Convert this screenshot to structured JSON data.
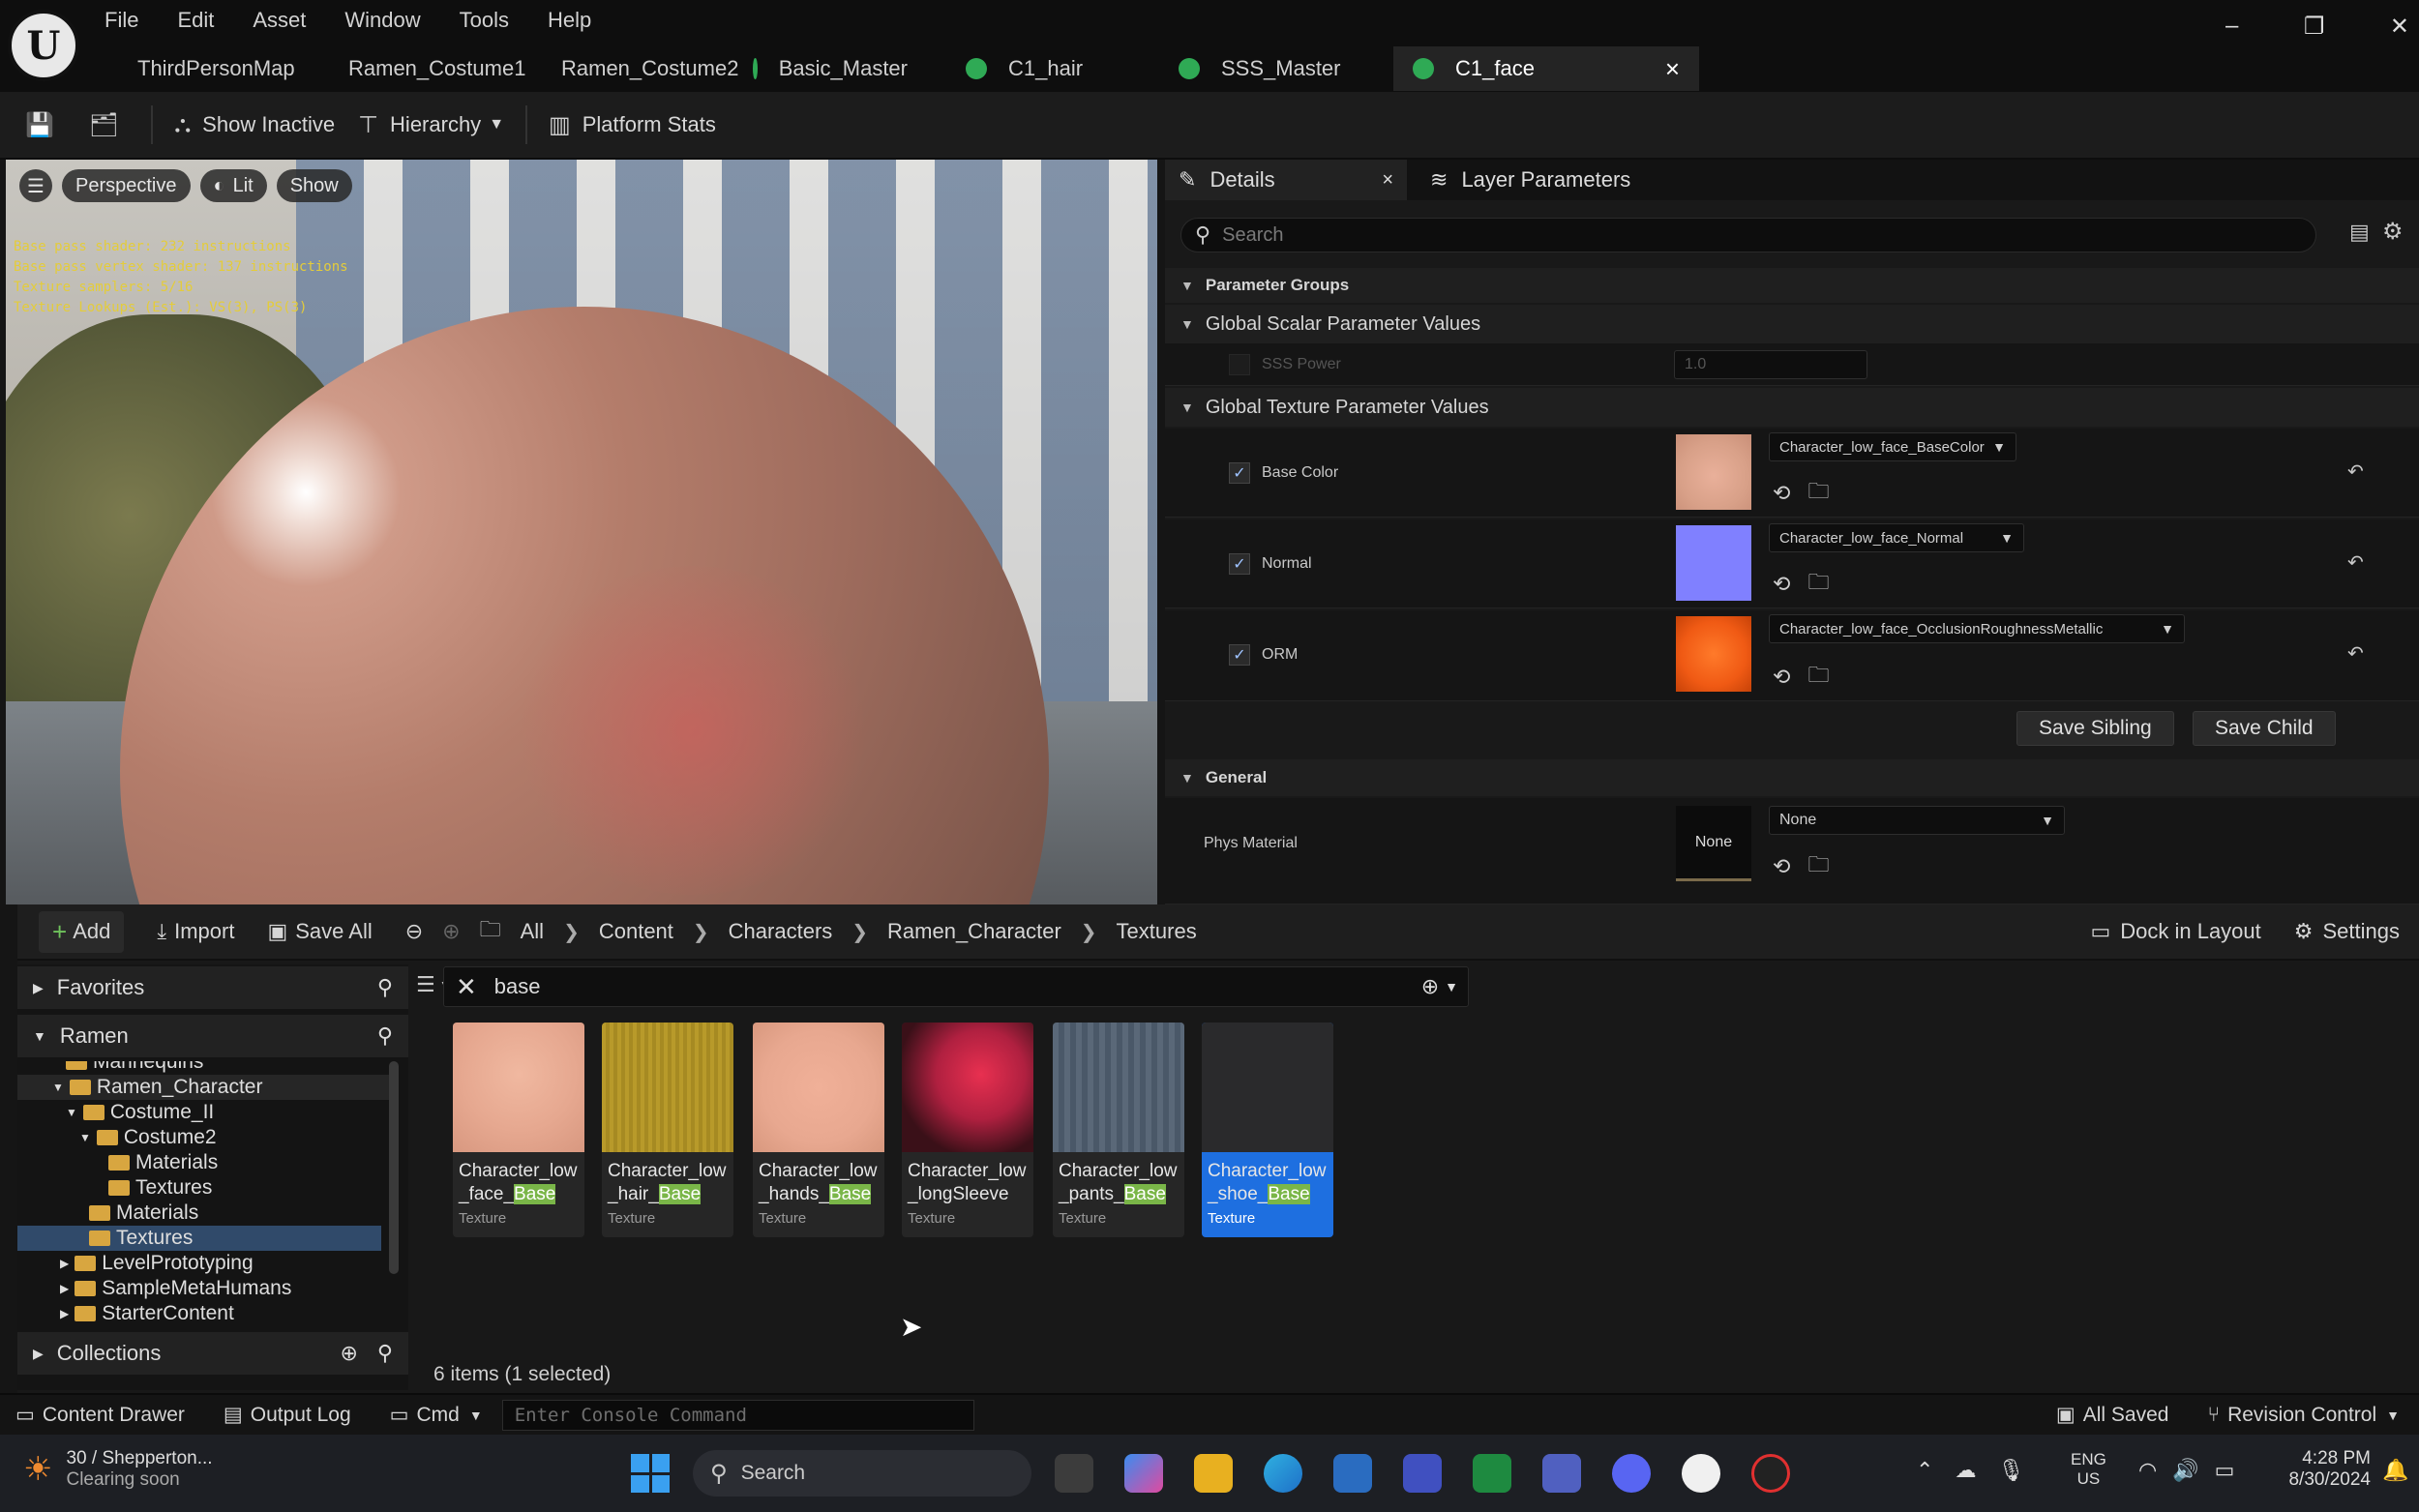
{
  "menu": [
    "File",
    "Edit",
    "Asset",
    "Window",
    "Tools",
    "Help"
  ],
  "tabs": [
    {
      "label": "ThirdPersonMap",
      "color": "#e0a020"
    },
    {
      "label": "Ramen_Costume1",
      "color": "#38a0a0"
    },
    {
      "label": "Ramen_Costume2",
      "color": "#38a0a0"
    },
    {
      "label": "Basic_Master",
      "color": "#2faa55"
    },
    {
      "label": "C1_hair",
      "color": "#2faa55"
    },
    {
      "label": "SSS_Master",
      "color": "#2faa55"
    },
    {
      "label": "C1_face",
      "color": "#2faa55",
      "active": true
    }
  ],
  "window": {
    "minimize": "–",
    "restore": "❐",
    "close": "✕",
    "tab_close": "×"
  },
  "toolbar": {
    "show_inactive": "Show Inactive",
    "hierarchy": "Hierarchy",
    "platform_stats": "Platform Stats"
  },
  "viewport": {
    "perspective": "Perspective",
    "lit": "Lit",
    "show": "Show",
    "stats": [
      "Base pass shader: 232 instructions",
      "Base pass vertex shader: 137 instructions",
      "Texture samplers: 5/16",
      "Texture Lookups (Est.): VS(3), PS(3)"
    ]
  },
  "details": {
    "tab_details": "Details",
    "tab_layer": "Layer Parameters",
    "search_placeholder": "Search",
    "parameter_groups": "Parameter Groups",
    "scalar_header": "Global Scalar Parameter Values",
    "sss_power_label": "SSS Power",
    "sss_power_value": "1.0",
    "texture_header": "Global Texture Parameter Values",
    "textures": [
      {
        "label": "Base Color",
        "asset": "Character_low_face_BaseColor",
        "checked": true,
        "swatch": "#d8a088"
      },
      {
        "label": "Normal",
        "asset": "Character_low_face_Normal",
        "checked": true,
        "swatch": "#8080ff"
      },
      {
        "label": "ORM",
        "asset": "Character_low_face_OcclusionRoughnessMetallic",
        "checked": true,
        "swatch": "#f05a14"
      }
    ],
    "save_sibling": "Save Sibling",
    "save_child": "Save Child",
    "general_header": "General",
    "phys_material_label": "Phys Material",
    "phys_material_thumb": "None",
    "phys_material_value": "None"
  },
  "drawer": {
    "add": "Add",
    "import": "Import",
    "save_all": "Save All",
    "breadcrumbs": [
      "All",
      "Content",
      "Characters",
      "Ramen_Character",
      "Textures"
    ],
    "dock": "Dock in Layout",
    "settings": "Settings",
    "favorites": "Favorites",
    "ramen": "Ramen",
    "collections": "Collections",
    "tree": [
      {
        "label": "Mannequins",
        "indent": 50
      },
      {
        "label": "Ramen_Character",
        "indent": 36
      },
      {
        "label": "Costume_II",
        "indent": 50
      },
      {
        "label": "Costume2",
        "indent": 64
      },
      {
        "label": "Materials",
        "indent": 80
      },
      {
        "label": "Textures",
        "indent": 80
      },
      {
        "label": "Materials",
        "indent": 60
      },
      {
        "label": "Textures",
        "indent": 60,
        "selected": true
      },
      {
        "label": "LevelPrototyping",
        "indent": 30
      },
      {
        "label": "SampleMetaHumans",
        "indent": 30
      },
      {
        "label": "StarterContent",
        "indent": 30
      }
    ],
    "filter_text": "base",
    "assets": [
      {
        "line1": "Character_low",
        "line2pre": "_face_",
        "hl": "Base",
        "type": "Texture",
        "color": "#e6a890"
      },
      {
        "line1": "Character_low",
        "line2pre": "_hair_",
        "hl": "Base",
        "type": "Texture",
        "color": "#b89a2a"
      },
      {
        "line1": "Character_low",
        "line2pre": "_hands_",
        "hl": "Base",
        "type": "Texture",
        "color": "#e8a890"
      },
      {
        "line1": "Character_low",
        "line2pre": "_longSleeve",
        "hl": "",
        "type": "Texture",
        "color": "#b02040"
      },
      {
        "line1": "Character_low",
        "line2pre": "_pants_",
        "hl": "Base",
        "type": "Texture",
        "color": "#5a6878"
      },
      {
        "line1": "Character_low",
        "line2pre": "_shoe_",
        "hl": "Base",
        "type": "Texture",
        "color": "#2a2a2c",
        "selected": true
      }
    ],
    "count": "6 items (1 selected)"
  },
  "status": {
    "content_drawer": "Content Drawer",
    "output_log": "Output Log",
    "cmd": "Cmd",
    "console_placeholder": "Enter Console Command",
    "all_saved": "All Saved",
    "revision": "Revision Control"
  },
  "taskbar": {
    "weather_line1": "30 / Shepperton...",
    "weather_line2": "Clearing soon",
    "search": "Search",
    "lang1": "ENG",
    "lang2": "US",
    "time": "4:28 PM",
    "date": "8/30/2024"
  }
}
